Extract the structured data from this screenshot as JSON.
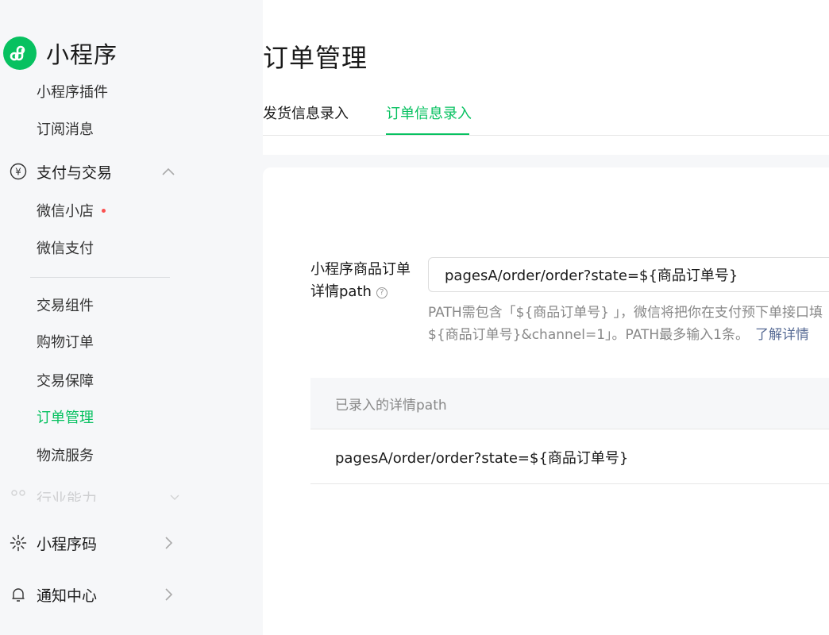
{
  "sidebar": {
    "brand_name": "小程序",
    "items": [
      {
        "label": "小程序插件"
      },
      {
        "label": "订阅消息"
      },
      {
        "label": "支付与交易"
      },
      {
        "label": "微信小店"
      },
      {
        "label": "微信支付"
      },
      {
        "label": "交易组件"
      },
      {
        "label": "购物订单"
      },
      {
        "label": "交易保障"
      },
      {
        "label": "订单管理"
      },
      {
        "label": "物流服务"
      },
      {
        "label": "行业能力"
      },
      {
        "label": "小程序码"
      },
      {
        "label": "通知中心"
      }
    ],
    "active_item": "订单管理",
    "accent_color": "#07c160",
    "badge_color": "#fa5151"
  },
  "main": {
    "title": "订单管理",
    "tabs": [
      {
        "label": "发货信息录入"
      },
      {
        "label": "订单信息录入"
      }
    ],
    "active_tab": "订单信息录入",
    "form": {
      "label": "小程序商品订单详情path",
      "input_value": "pagesA/order/order?state=${商品订单号}",
      "hint_line1": "PATH需包含「${商品订单号} 」，微信将把你在支付预下单接口填",
      "hint_line2": "${商品订单号}&channel=1」。PATH最多输入1条。",
      "hint_link": "了解详情"
    },
    "table": {
      "header": "已录入的详情path",
      "rows": [
        {
          "path": "pagesA/order/order?state=${商品订单号}"
        }
      ]
    }
  }
}
